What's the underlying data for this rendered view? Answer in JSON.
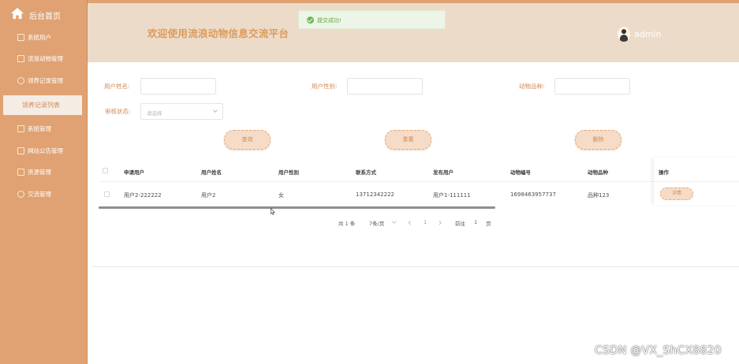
{
  "sidebar": {
    "home": "后台首页",
    "items": [
      {
        "label": "系统用户",
        "icon": "user-icon"
      },
      {
        "label": "流浪动物管理",
        "icon": "paw-icon"
      },
      {
        "label": "领养记录管理",
        "icon": "record-icon"
      },
      {
        "label": "领养记录列表",
        "active": true
      },
      {
        "label": "系统管理",
        "icon": "settings-icon"
      },
      {
        "label": "网站公告管理",
        "icon": "notice-icon"
      },
      {
        "label": "资源管理",
        "icon": "resource-icon"
      },
      {
        "label": "交流管理",
        "icon": "chat-icon"
      }
    ]
  },
  "header": {
    "title": "欢迎使用流浪动物信息交流平台",
    "user": "admin"
  },
  "toast": {
    "message": "提交成功!"
  },
  "search": {
    "user_name_label": "用户姓名:",
    "user_gender_label": "用户性别:",
    "animal_breed_label": "动物品种:",
    "review_status_label": "审核状态:",
    "review_status_placeholder": "请选择",
    "query_button": "查询",
    "reset_button": "重置",
    "delete_button": "删除"
  },
  "table": {
    "headers": [
      "申请用户",
      "用户姓名",
      "用户性别",
      "联系方式",
      "发布用户",
      "动物编号",
      "动物品种",
      "操作"
    ],
    "rows": [
      {
        "applicant": "用户2-222222",
        "name": "用户2",
        "gender": "女",
        "phone": "13712342222",
        "publisher": "用户1-111111",
        "animal_no": "1698463957737",
        "breed": "品种123",
        "action": "详情"
      }
    ]
  },
  "pagination": {
    "total": "共 1 条",
    "page_size": "7条/页",
    "current_page": "1",
    "goto_label": "前往",
    "goto_value": "1",
    "page_unit": "页"
  },
  "watermark": "CSDN @VX_ShCX8820"
}
